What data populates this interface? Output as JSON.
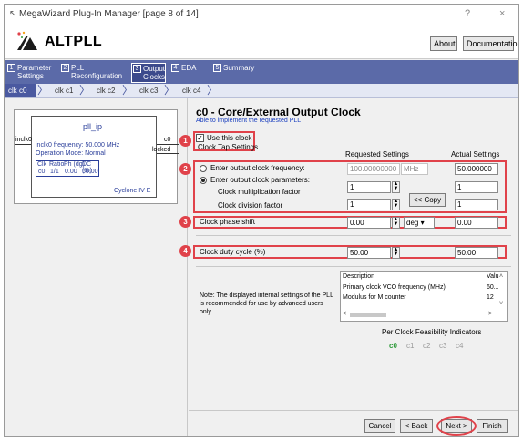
{
  "window": {
    "title": "MegaWizard Plug-In Manager [page 8 of 14]",
    "help": "?",
    "close": "×"
  },
  "header": {
    "app_title": "ALTPLL",
    "about": "About",
    "documentation": "Documentation"
  },
  "steps": [
    {
      "num": "1",
      "label1": "Parameter",
      "label2": "Settings"
    },
    {
      "num": "2",
      "label1": "PLL",
      "label2": "Reconfiguration"
    },
    {
      "num": "3",
      "label1": "Output",
      "label2": "Clocks"
    },
    {
      "num": "4",
      "label1": "EDA",
      "label2": ""
    },
    {
      "num": "5",
      "label1": "Summary",
      "label2": ""
    }
  ],
  "clock_tabs": [
    "clk c0",
    "clk c1",
    "clk c2",
    "clk c3",
    "clk c4"
  ],
  "block": {
    "name": "pll_ip",
    "input": "inclk0",
    "out_c0": "c0",
    "out_locked": "locked",
    "freq_line": "inclk0 frequency: 50.000 MHz",
    "mode_line": "Operation Mode: Normal",
    "table_headers": [
      "Clk",
      "Ratio",
      "Ph (dg)",
      "DC (%)"
    ],
    "table_row": [
      "c0",
      "1/1",
      "0.00",
      "50.00"
    ],
    "device": "Cyclone IV E"
  },
  "section": {
    "title": "c0 - Core/External Output Clock",
    "subtitle": "Able to implement the requested PLL"
  },
  "badges": [
    "1",
    "2",
    "3",
    "4"
  ],
  "use_clock": {
    "label": "Use this clock",
    "checked": true
  },
  "tap_settings": "Clock Tap Settings",
  "col_requested": "Requested Settings",
  "col_actual": "Actual Settings",
  "freq_option": {
    "label": "Enter output clock frequency:",
    "value": "100.00000000",
    "unit": "MHz",
    "actual": "50.000000"
  },
  "param_option": {
    "label": "Enter output clock parameters:"
  },
  "mult": {
    "label": "Clock multiplication factor",
    "value": "1",
    "actual": "1"
  },
  "div": {
    "label": "Clock division factor",
    "value": "1",
    "actual": "1"
  },
  "copy_button": "<< Copy",
  "phase": {
    "label": "Clock phase shift",
    "value": "0.00",
    "unit": "deg",
    "actual": "0.00"
  },
  "duty": {
    "label": "Clock duty cycle (%)",
    "value": "50.00",
    "actual": "50.00"
  },
  "note": "Note: The displayed internal settings of the PLL is recommended for use by advanced users only",
  "desc_table": {
    "header": "Description",
    "header_val": "Valu",
    "rows": [
      {
        "label": "Primary clock VCO frequency (MHz)",
        "value": "60..."
      },
      {
        "label": "Modulus for M counter",
        "value": "12"
      }
    ]
  },
  "feasibility": {
    "title": "Per Clock Feasibility Indicators",
    "clocks": [
      "c0",
      "c1",
      "c2",
      "c3",
      "c4"
    ]
  },
  "footer": {
    "cancel": "Cancel",
    "back": "< Back",
    "next": "Next >",
    "finish": "Finish"
  },
  "colors": {
    "accent": "#5b6aa8",
    "highlight": "#e0424a",
    "active_clock": "#2e9a3a"
  }
}
